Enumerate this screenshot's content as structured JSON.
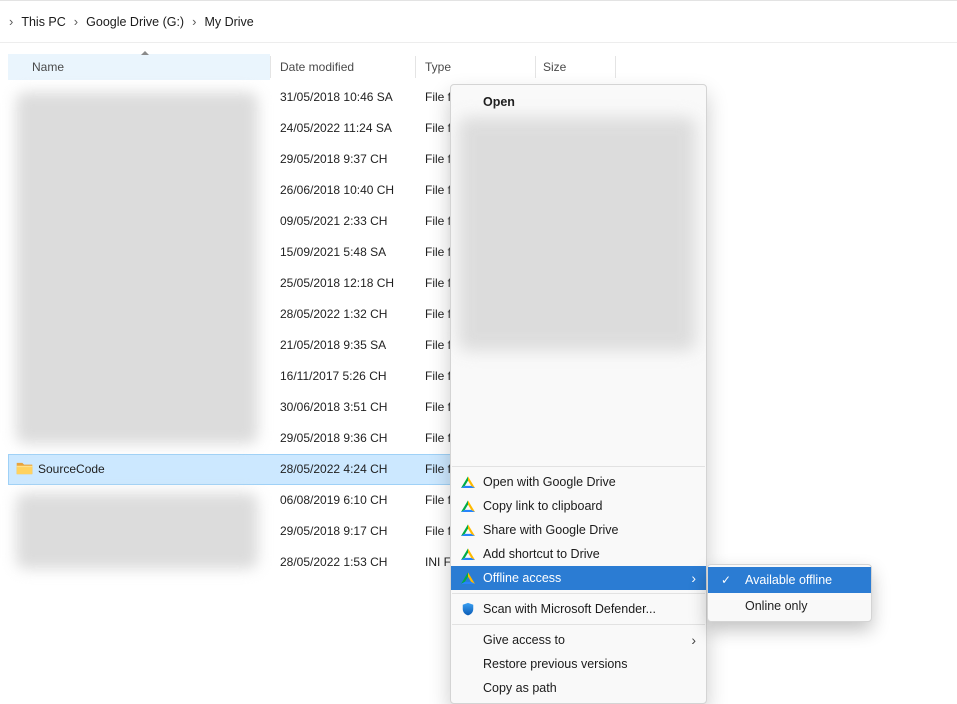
{
  "breadcrumb": {
    "items": [
      "This PC",
      "Google Drive (G:)",
      "My Drive"
    ]
  },
  "columns": {
    "name": "Name",
    "date_modified": "Date modified",
    "type": "Type",
    "size": "Size"
  },
  "files": [
    {
      "name": "",
      "date": "31/05/2018 10:46 SA",
      "type": "File folder"
    },
    {
      "name": "",
      "date": "24/05/2022 11:24 SA",
      "type": "File folder"
    },
    {
      "name": "",
      "date": "29/05/2018 9:37 CH",
      "type": "File folder"
    },
    {
      "name": "",
      "date": "26/06/2018 10:40 CH",
      "type": "File folder"
    },
    {
      "name": "",
      "date": "09/05/2021 2:33 CH",
      "type": "File folder"
    },
    {
      "name": "",
      "date": "15/09/2021 5:48 SA",
      "type": "File folder"
    },
    {
      "name": "",
      "date": "25/05/2018 12:18 CH",
      "type": "File folder"
    },
    {
      "name": "",
      "date": "28/05/2022 1:32 CH",
      "type": "File folder"
    },
    {
      "name": "",
      "date": "21/05/2018 9:35 SA",
      "type": "File folder"
    },
    {
      "name": "",
      "date": "16/11/2017 5:26 CH",
      "type": "File folder"
    },
    {
      "name": "",
      "date": "30/06/2018 3:51 CH",
      "type": "File folder"
    },
    {
      "name": "",
      "date": "29/05/2018 9:36 CH",
      "type": "File folder"
    },
    {
      "name": "SourceCode",
      "date": "28/05/2022 4:24 CH",
      "type": "File folder"
    },
    {
      "name": "",
      "date": "06/08/2019 6:10 CH",
      "type": "File folder"
    },
    {
      "name": "",
      "date": "29/05/2018 9:17 CH",
      "type": "File folder"
    },
    {
      "name": "",
      "date": "28/05/2022 1:53 CH",
      "type": "INI File"
    }
  ],
  "context_menu": {
    "open": "Open",
    "open_with_drive": "Open with Google Drive",
    "copy_link": "Copy link to clipboard",
    "share_drive": "Share with Google Drive",
    "add_shortcut": "Add shortcut to Drive",
    "offline_access": "Offline access",
    "scan_defender": "Scan with Microsoft Defender...",
    "give_access": "Give access to",
    "restore_versions": "Restore previous versions",
    "copy_as_path": "Copy as path"
  },
  "submenu": {
    "available_offline": "Available offline",
    "online_only": "Online only"
  },
  "icons": {
    "breadcrumb_chevron": "›",
    "submenu_arrow": "›",
    "checkmark": "✓"
  },
  "colors": {
    "highlight_blue": "#2b7cd3",
    "selection_blue": "#cce8ff"
  }
}
